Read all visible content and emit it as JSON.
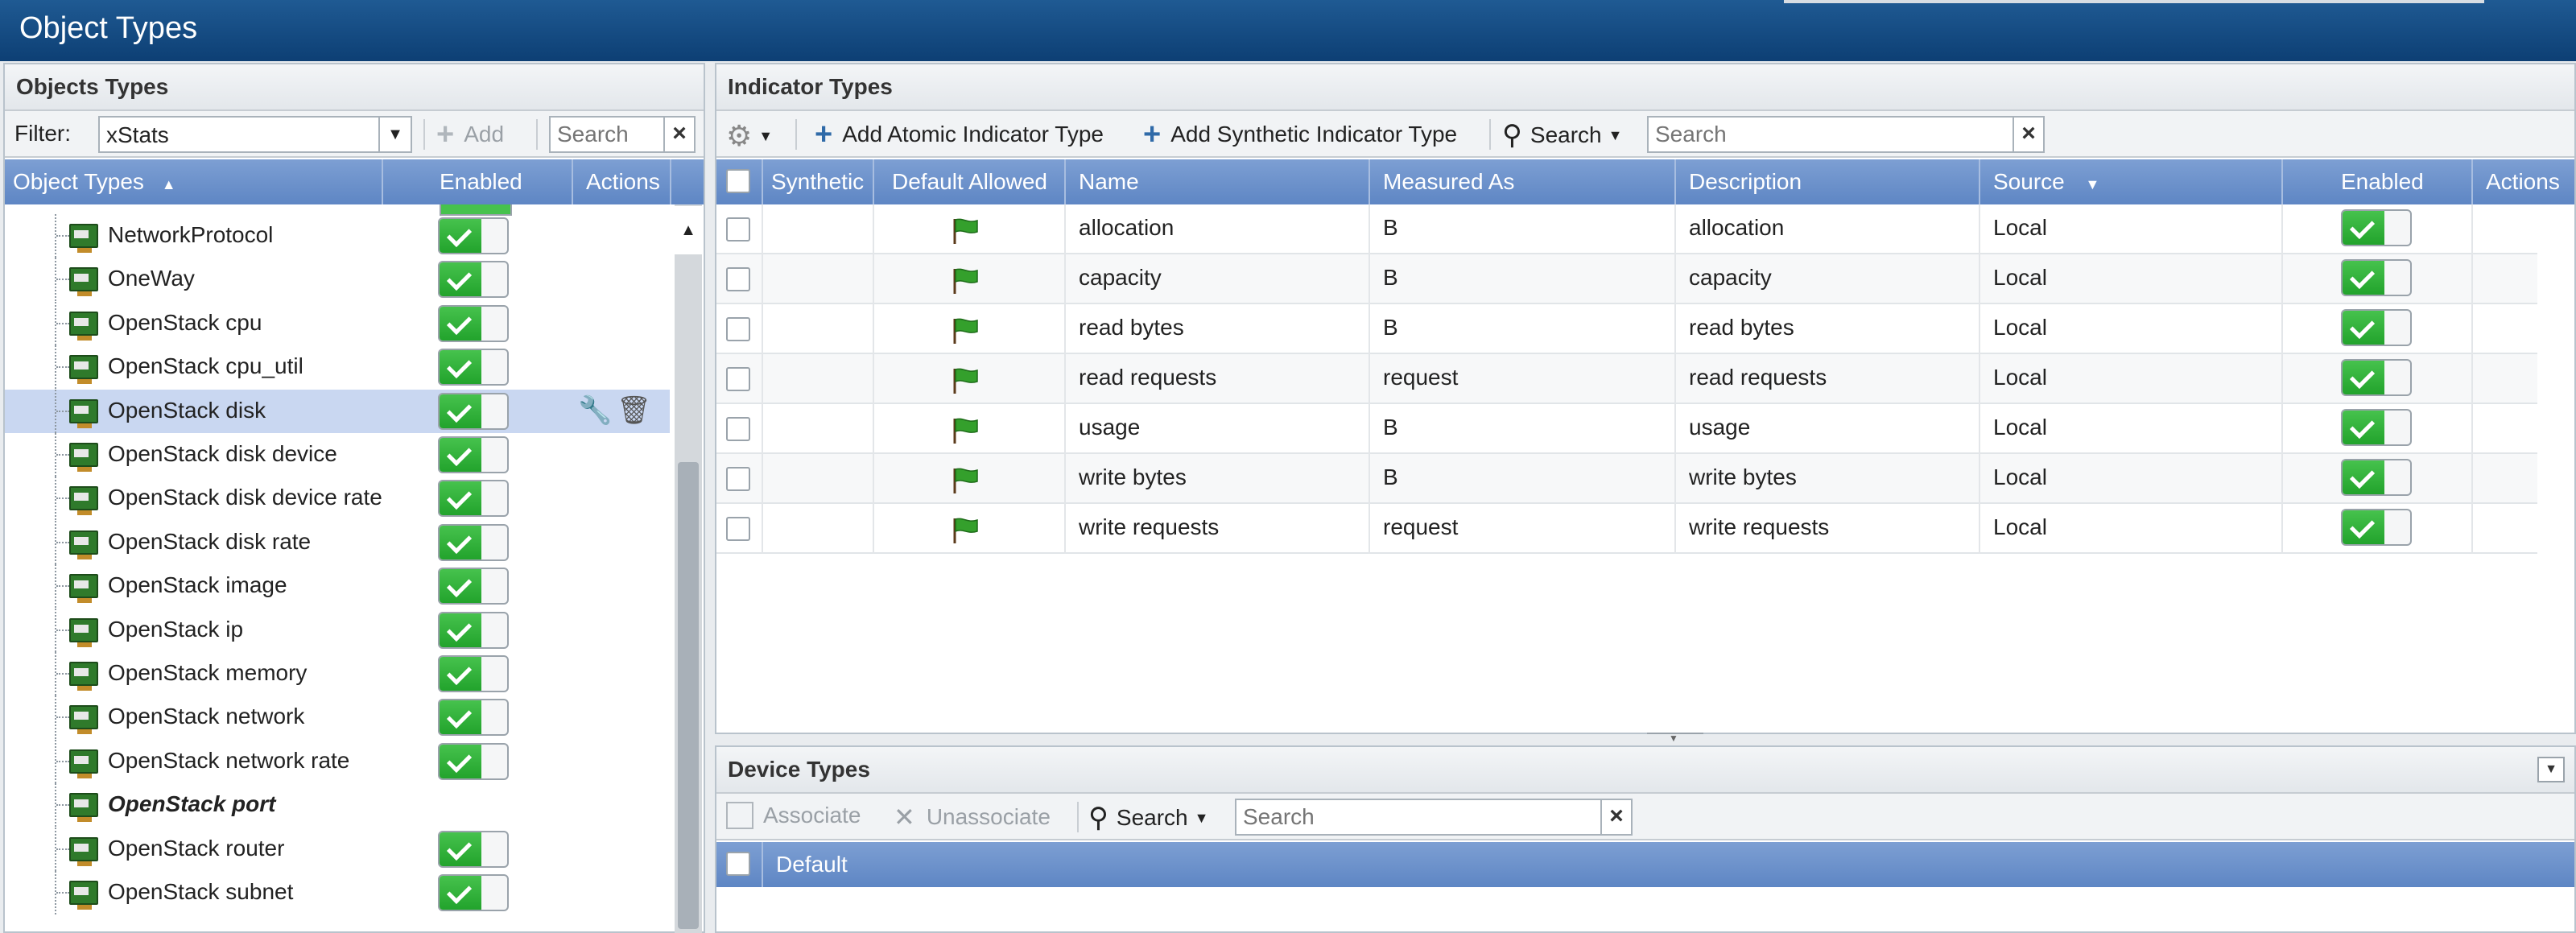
{
  "window": {
    "title": "Object Types"
  },
  "left": {
    "title": "Objects Types",
    "filter_label": "Filter:",
    "filter_value": "xStats",
    "add_label": "Add",
    "search_placeholder": "Search",
    "columns": [
      "Object Types",
      "Enabled",
      "Actions"
    ],
    "rows": [
      {
        "label": "NetworkProtocol",
        "enabled": true
      },
      {
        "label": "OneWay",
        "enabled": true
      },
      {
        "label": "OpenStack cpu",
        "enabled": true
      },
      {
        "label": "OpenStack cpu_util",
        "enabled": true
      },
      {
        "label": "OpenStack disk",
        "enabled": true,
        "selected": true
      },
      {
        "label": "OpenStack disk device",
        "enabled": true
      },
      {
        "label": "OpenStack disk device rate",
        "enabled": true
      },
      {
        "label": "OpenStack disk rate",
        "enabled": true
      },
      {
        "label": "OpenStack image",
        "enabled": true
      },
      {
        "label": "OpenStack ip",
        "enabled": true
      },
      {
        "label": "OpenStack memory",
        "enabled": true
      },
      {
        "label": "OpenStack network",
        "enabled": true
      },
      {
        "label": "OpenStack network rate",
        "enabled": true
      },
      {
        "label": "OpenStack port",
        "enabled": false,
        "emphasis": true
      },
      {
        "label": "OpenStack router",
        "enabled": true
      },
      {
        "label": "OpenStack subnet",
        "enabled": true
      }
    ]
  },
  "indicators": {
    "title": "Indicator Types",
    "add_atomic_label": "Add Atomic Indicator Type",
    "add_synthetic_label": "Add Synthetic Indicator Type",
    "search_label": "Search",
    "search_placeholder": "Search",
    "columns": [
      "Synthetic",
      "Default Allowed",
      "Name",
      "Measured As",
      "Description",
      "Source",
      "Enabled",
      "Actions"
    ],
    "rows": [
      {
        "name": "allocation",
        "measured": "B",
        "description": "allocation",
        "source": "Local"
      },
      {
        "name": "capacity",
        "measured": "B",
        "description": "capacity",
        "source": "Local"
      },
      {
        "name": "read bytes",
        "measured": "B",
        "description": "read bytes",
        "source": "Local"
      },
      {
        "name": "read requests",
        "measured": "request",
        "description": "read requests",
        "source": "Local"
      },
      {
        "name": "usage",
        "measured": "B",
        "description": "usage",
        "source": "Local"
      },
      {
        "name": "write bytes",
        "measured": "B",
        "description": "write bytes",
        "source": "Local"
      },
      {
        "name": "write requests",
        "measured": "request",
        "description": "write requests",
        "source": "Local"
      }
    ]
  },
  "devices": {
    "title": "Device Types",
    "associate_label": "Associate",
    "unassociate_label": "Unassociate",
    "search_label": "Search",
    "search_placeholder": "Search",
    "column": "Default"
  },
  "colors": {
    "accent": "#0d3f74",
    "grid_header": "#5e86c4",
    "toggle_on": "#22a32c"
  }
}
